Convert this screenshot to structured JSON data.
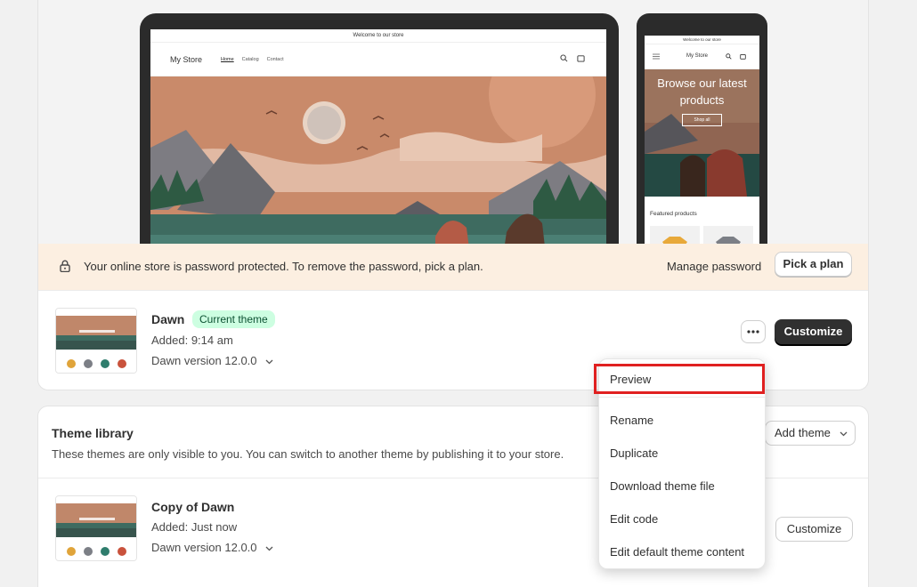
{
  "storefront": {
    "announcement": "Welcome to our store",
    "store_name": "My Store",
    "nav": [
      "Home",
      "Catalog",
      "Contact"
    ],
    "mobile_hero_title": "Browse our latest products",
    "mobile_shop_all": "Shop all",
    "featured_products": "Featured products"
  },
  "banner": {
    "message": "Your online store is password protected. To remove the password, pick a plan.",
    "manage_password": "Manage password",
    "pick_plan": "Pick a plan"
  },
  "current_theme": {
    "name": "Dawn",
    "badge": "Current theme",
    "added": "Added: 9:14 am",
    "version": "Dawn version 12.0.0",
    "customize": "Customize"
  },
  "menu": {
    "items": [
      "Preview",
      "Rename",
      "Duplicate",
      "Download theme file",
      "Edit code",
      "Edit default theme content"
    ]
  },
  "library": {
    "title": "Theme library",
    "description": "These themes are only visible to you. You can switch to another theme by publishing it to your store.",
    "add_theme": "Add theme",
    "themes": [
      {
        "name": "Copy of Dawn",
        "added": "Added: Just now",
        "version": "Dawn version 12.0.0",
        "customize": "Customize"
      }
    ]
  },
  "colors": {
    "banner_bg": "#fcefe1",
    "badge_bg": "#cdfee1",
    "primary_button": "#303030",
    "highlight_outline": "#e02020"
  }
}
